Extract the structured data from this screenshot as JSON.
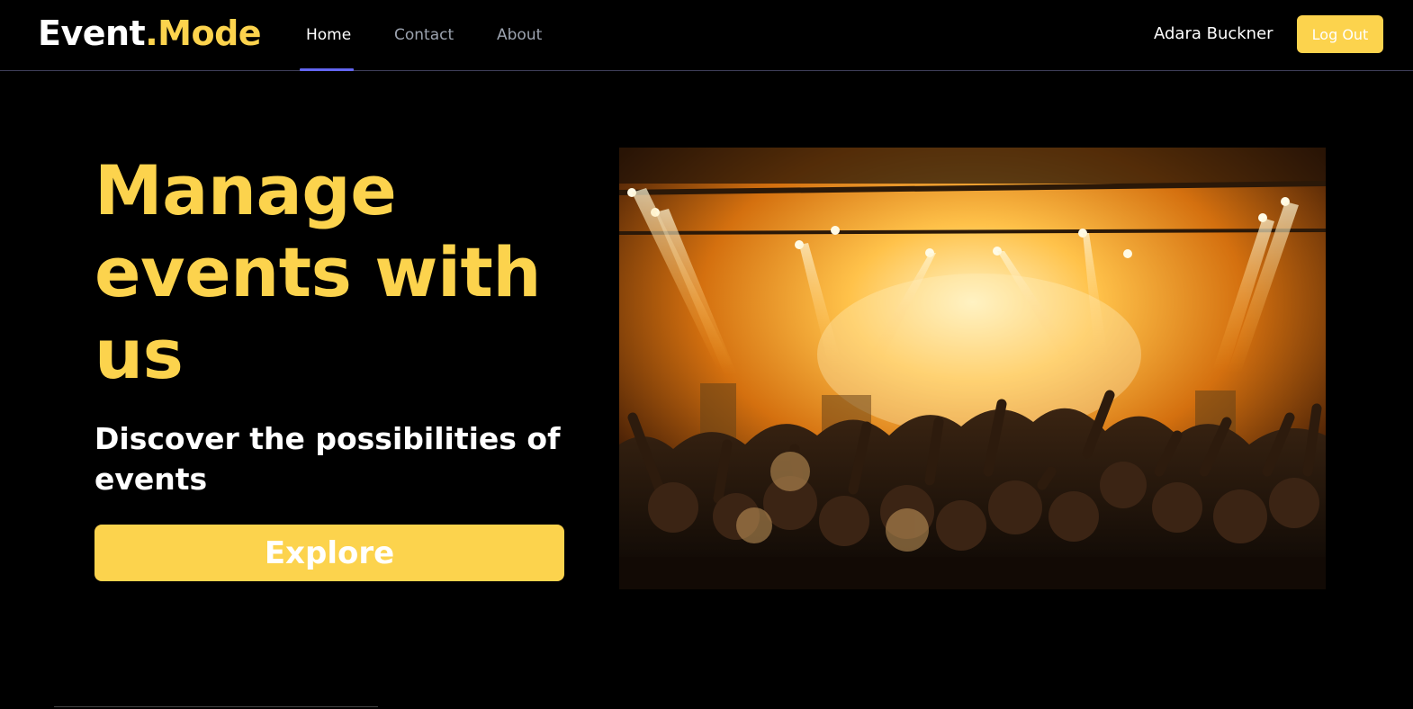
{
  "brand": {
    "name": "Event",
    "dot_suffix": ".Mode"
  },
  "nav": {
    "links": [
      {
        "label": "Home",
        "active": true
      },
      {
        "label": "Contact",
        "active": false
      },
      {
        "label": "About",
        "active": false
      }
    ]
  },
  "user": {
    "name": "Adara Buckner",
    "logout_label": "Log Out"
  },
  "hero": {
    "title": "Manage events with us",
    "subtitle": "Discover the possibilities of events",
    "cta_label": "Explore",
    "image": "concert-crowd-stage-lights-photo"
  },
  "colors": {
    "background": "#000000",
    "accent": "#fcd34d",
    "nav_active_underline": "#6366f1",
    "nav_inactive": "#9ca3af"
  }
}
